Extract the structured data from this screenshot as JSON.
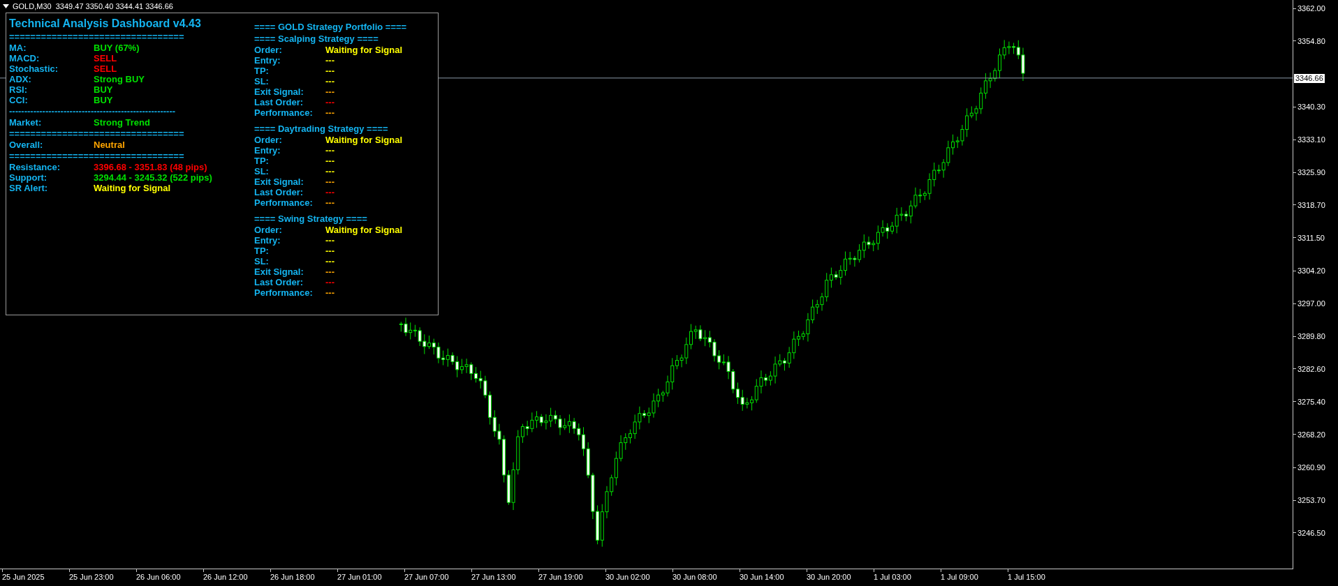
{
  "chart_header": {
    "title": "GOLD,M30  3349.47 3350.40 3344.41 3346.66"
  },
  "dashboard": {
    "title": "Technical Analysis Dashboard v4.43",
    "indicators": [
      {
        "kind": "separator",
        "text": "================================="
      },
      {
        "kind": "row",
        "label": "MA:",
        "value": "BUY (67%)",
        "color": "#00e000"
      },
      {
        "kind": "row",
        "label": "MACD:",
        "value": "SELL",
        "color": "#ff0000"
      },
      {
        "kind": "row",
        "label": "Stochastic:",
        "value": "SELL",
        "color": "#ff0000"
      },
      {
        "kind": "row",
        "label": "ADX:",
        "value": "Strong BUY",
        "color": "#00e000"
      },
      {
        "kind": "row",
        "label": "RSI:",
        "value": "BUY",
        "color": "#00e000"
      },
      {
        "kind": "row",
        "label": "CCI:",
        "value": "BUY",
        "color": "#00e000"
      },
      {
        "kind": "separator",
        "text": "-------------------------------------------------------"
      },
      {
        "kind": "row",
        "label": "Market:",
        "value": "Strong Trend",
        "color": "#00e000"
      },
      {
        "kind": "separator",
        "text": "================================="
      },
      {
        "kind": "row",
        "label": "Overall:",
        "value": "Neutral",
        "color": "#ffa500"
      },
      {
        "kind": "separator",
        "text": "================================="
      },
      {
        "kind": "row",
        "label": "Resistance:",
        "value": "3396.68 - 3351.83 (48 pips)",
        "color": "#ff0000"
      },
      {
        "kind": "row",
        "label": "Support:",
        "value": "3294.44 - 3245.32 (522 pips)",
        "color": "#00e000"
      },
      {
        "kind": "row",
        "label": "SR Alert:",
        "value": "Waiting for Signal",
        "color": "#ffff00"
      }
    ],
    "portfolio_title": "==== GOLD Strategy Portfolio ====",
    "strategies": [
      {
        "title": "==== Scalping Strategy ====",
        "rows": [
          {
            "label": "Order:",
            "value": "Waiting for Signal",
            "color": "#ffff00"
          },
          {
            "label": "Entry:",
            "value": "---",
            "color": "#ffff00"
          },
          {
            "label": "TP:",
            "value": "---",
            "color": "#ffff00"
          },
          {
            "label": "SL:",
            "value": "---",
            "color": "#ffff00"
          },
          {
            "label": "Exit Signal:",
            "value": "---",
            "color": "#ffa500"
          },
          {
            "label": "Last Order:",
            "value": "---",
            "color": "#ff0000"
          },
          {
            "label": "Performance:",
            "value": "---",
            "color": "#ffa500"
          }
        ]
      },
      {
        "title": "==== Daytrading Strategy ====",
        "rows": [
          {
            "label": "Order:",
            "value": "Waiting for Signal",
            "color": "#ffff00"
          },
          {
            "label": "Entry:",
            "value": "---",
            "color": "#ffff00"
          },
          {
            "label": "TP:",
            "value": "---",
            "color": "#ffff00"
          },
          {
            "label": "SL:",
            "value": "---",
            "color": "#ffff00"
          },
          {
            "label": "Exit Signal:",
            "value": "---",
            "color": "#ffa500"
          },
          {
            "label": "Last Order:",
            "value": "---",
            "color": "#ff0000"
          },
          {
            "label": "Performance:",
            "value": "---",
            "color": "#ffa500"
          }
        ]
      },
      {
        "title": "==== Swing Strategy ====",
        "rows": [
          {
            "label": "Order:",
            "value": "Waiting for Signal",
            "color": "#ffff00"
          },
          {
            "label": "Entry:",
            "value": "---",
            "color": "#ffff00"
          },
          {
            "label": "TP:",
            "value": "---",
            "color": "#ffff00"
          },
          {
            "label": "SL:",
            "value": "---",
            "color": "#ffff00"
          },
          {
            "label": "Exit Signal:",
            "value": "---",
            "color": "#ffa500"
          },
          {
            "label": "Last Order:",
            "value": "---",
            "color": "#ff0000"
          },
          {
            "label": "Performance:",
            "value": "---",
            "color": "#ffa500"
          }
        ]
      }
    ]
  },
  "price_axis": {
    "labels": [
      "3362.00",
      "3354.80",
      "3340.30",
      "3333.10",
      "3325.90",
      "3318.70",
      "3311.50",
      "3304.20",
      "3297.00",
      "3289.80",
      "3282.60",
      "3275.40",
      "3268.20",
      "3260.90",
      "3253.70",
      "3246.50"
    ],
    "current_price": "3346.66"
  },
  "time_axis": {
    "labels": [
      "25 Jun 2025",
      "25 Jun 23:00",
      "26 Jun 06:00",
      "26 Jun 12:00",
      "26 Jun 18:00",
      "27 Jun 01:00",
      "27 Jun 07:00",
      "27 Jun 13:00",
      "27 Jun 19:00",
      "30 Jun 02:00",
      "30 Jun 08:00",
      "30 Jun 14:00",
      "30 Jun 20:00",
      "1 Jul 03:00",
      "1 Jul 09:00",
      "1 Jul 15:00"
    ]
  }
}
